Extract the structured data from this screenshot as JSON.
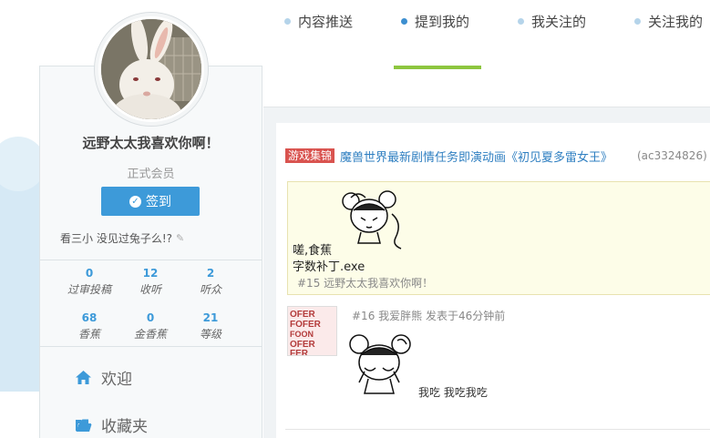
{
  "profile": {
    "username": "远野太太我喜欢你啊！",
    "rank": "正式会员",
    "signin_label": "签到",
    "signature": "看三小 没见过兔子么!?"
  },
  "stats": [
    {
      "value": "0",
      "label": "过审投稿"
    },
    {
      "value": "12",
      "label": "收听"
    },
    {
      "value": "2",
      "label": "听众"
    },
    {
      "value": "68",
      "label": "香蕉"
    },
    {
      "value": "0",
      "label": "金香蕉"
    },
    {
      "value": "21",
      "label": "等级"
    }
  ],
  "menu": [
    {
      "label": "欢迎",
      "icon": "home-icon"
    },
    {
      "label": "收藏夹",
      "icon": "folder-icon"
    }
  ],
  "tabs": [
    {
      "label": "内容推送",
      "active": false
    },
    {
      "label": "提到我的",
      "active": true
    },
    {
      "label": "我关注的",
      "active": false
    },
    {
      "label": "关注我的",
      "active": false
    }
  ],
  "feed": {
    "tag": "游戏集锦",
    "title": "魔兽世界最新剧情任务即演动画《初见夏多雷女王》",
    "ac_id": "(ac3324826)",
    "quote": {
      "line1": "嗟,食蕉",
      "line2": "字数补丁.exe",
      "ref": "#15 远野太太我喜欢你啊！"
    },
    "post": {
      "meta": "#16 我爱胖熊 发表于46分钟前",
      "text": "我吃 我吃我吃",
      "thumb_words": [
        "OFER",
        "FOFER",
        "FOON",
        "OFER",
        "FER"
      ]
    }
  },
  "colors": {
    "accent_blue": "#3d9ad9",
    "tab_active_bar": "#8dc63f",
    "tag_red": "#d9534f",
    "link_blue": "#2f7fc1"
  }
}
